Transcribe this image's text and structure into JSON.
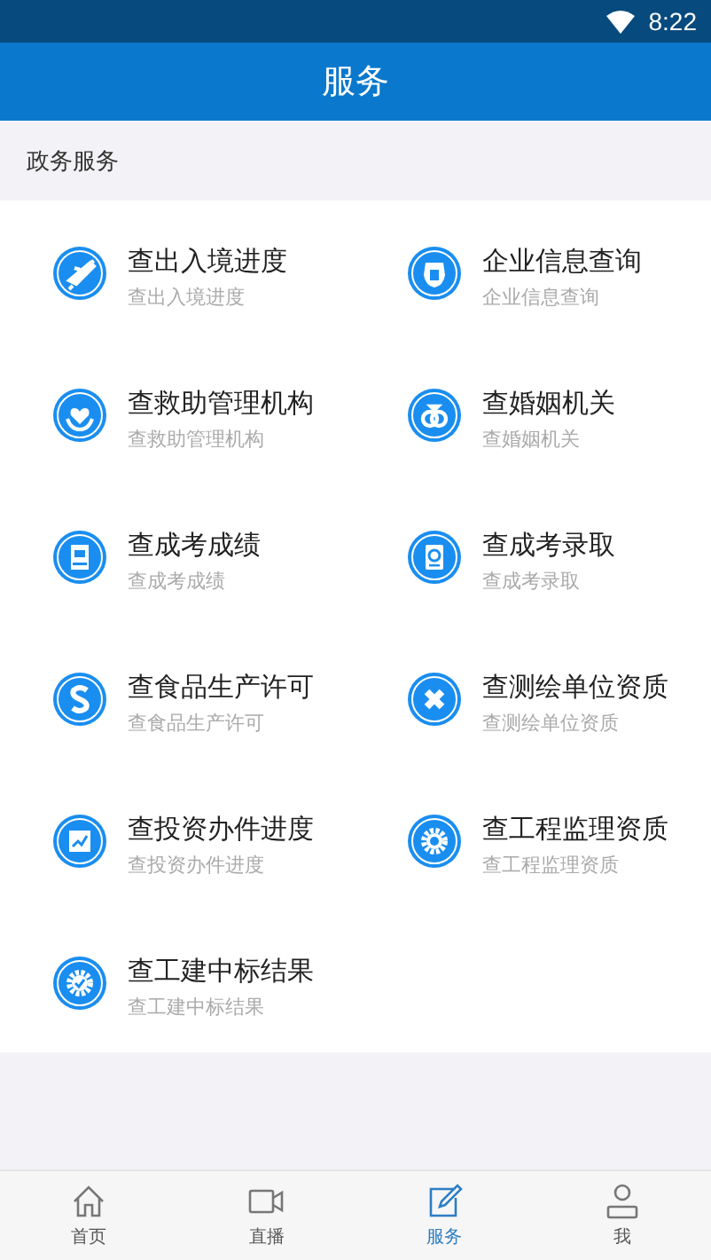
{
  "status_bar": {
    "time": "8:22"
  },
  "header": {
    "title": "服务"
  },
  "section": {
    "title": "政务服务"
  },
  "services": [
    {
      "title": "查出入境进度",
      "subtitle": "查出入境进度",
      "kind": "plane"
    },
    {
      "title": "企业信息查询",
      "subtitle": "企业信息查询",
      "kind": "shield"
    },
    {
      "title": "查救助管理机构",
      "subtitle": "查救助管理机构",
      "kind": "heart"
    },
    {
      "title": "查婚姻机关",
      "subtitle": "查婚姻机关",
      "kind": "rings"
    },
    {
      "title": "查成考成绩",
      "subtitle": "查成考成绩",
      "kind": "document"
    },
    {
      "title": "查成考录取",
      "subtitle": "查成考录取",
      "kind": "certificate"
    },
    {
      "title": "查食品生产许可",
      "subtitle": "查食品生产许可",
      "kind": "coin"
    },
    {
      "title": "查测绘单位资质",
      "subtitle": "查测绘单位资质",
      "kind": "ruler"
    },
    {
      "title": "查投资办件进度",
      "subtitle": "查投资办件进度",
      "kind": "chart"
    },
    {
      "title": "查工程监理资质",
      "subtitle": "查工程监理资质",
      "kind": "gear"
    },
    {
      "title": "查工建中标结果",
      "subtitle": "查工建中标结果",
      "kind": "check"
    }
  ],
  "tabs": [
    {
      "label": "首页",
      "kind": "home",
      "selected": false
    },
    {
      "label": "直播",
      "kind": "video",
      "selected": false
    },
    {
      "label": "服务",
      "kind": "edit",
      "selected": true
    },
    {
      "label": "我",
      "kind": "user",
      "selected": false
    }
  ]
}
